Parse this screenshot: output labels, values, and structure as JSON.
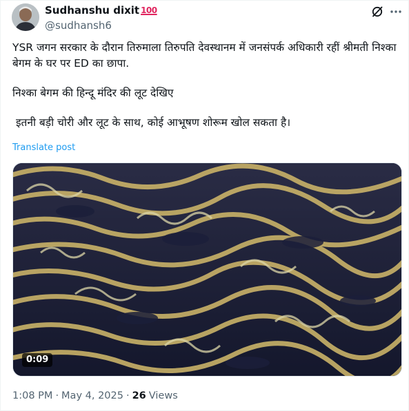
{
  "author": {
    "display_name": "Sudhanshu dixit",
    "badge": "100",
    "handle": "@sudhansh6"
  },
  "header_icons": [
    "grok-icon",
    "more-options-icon"
  ],
  "post": {
    "paragraphs": [
      "YSR जगन सरकार के दौरान तिरुमाला तिरुपति देवस्थानम में जनसंपर्क अधिकारी रहीं श्रीमती निश्का बेगम के घर पर ED का छापा.",
      "निश्का बेगम की हिन्दू मंदिर की लूट देखिए",
      " इतनी बड़ी चोरी और लूट के साथ, कोई आभूषण शोरूम खोल सकता है।"
    ],
    "translate_label": "Translate post"
  },
  "media": {
    "duration": "0:09",
    "colors": {
      "base": "#1b1f3a",
      "gold": "#c9b268",
      "light": "#dcd6a8"
    }
  },
  "meta": {
    "time": "1:08 PM",
    "separator_1": "·",
    "date": "May 4, 2025",
    "separator_2": "·",
    "views_count": "26",
    "views_label": "Views"
  },
  "colors": {
    "link": "#1d9bf0",
    "muted": "#536471",
    "text": "#0f1419"
  }
}
